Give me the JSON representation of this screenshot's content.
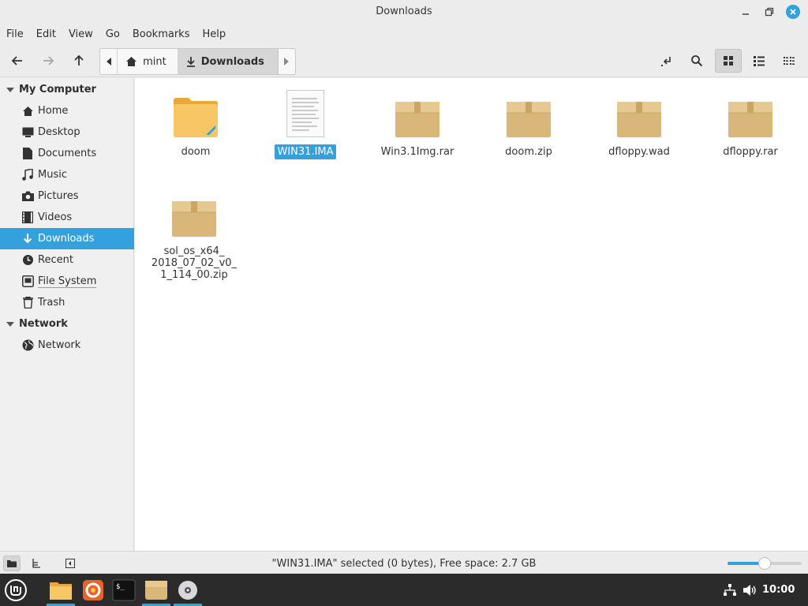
{
  "window": {
    "title": "Downloads"
  },
  "menu": [
    "File",
    "Edit",
    "View",
    "Go",
    "Bookmarks",
    "Help"
  ],
  "pathbar": {
    "crumbs": [
      {
        "label": "mint",
        "icon": "home-icon"
      },
      {
        "label": "Downloads",
        "icon": "download-icon"
      }
    ]
  },
  "sidebar": {
    "sections": [
      {
        "label": "My Computer",
        "items": [
          {
            "label": "Home",
            "icon": "home-icon"
          },
          {
            "label": "Desktop",
            "icon": "desktop-icon"
          },
          {
            "label": "Documents",
            "icon": "document-icon"
          },
          {
            "label": "Music",
            "icon": "music-icon"
          },
          {
            "label": "Pictures",
            "icon": "camera-icon"
          },
          {
            "label": "Videos",
            "icon": "film-icon"
          },
          {
            "label": "Downloads",
            "icon": "download-icon",
            "selected": true
          },
          {
            "label": "Recent",
            "icon": "clock-icon"
          },
          {
            "label": "File System",
            "icon": "drive-icon"
          },
          {
            "label": "Trash",
            "icon": "trash-icon"
          }
        ]
      },
      {
        "label": "Network",
        "items": [
          {
            "label": "Network",
            "icon": "globe-icon"
          }
        ]
      }
    ]
  },
  "files": [
    {
      "name": "doom",
      "type": "folder"
    },
    {
      "name": "WIN31.IMA",
      "type": "document",
      "selected": true
    },
    {
      "name": "Win3.1Img.rar",
      "type": "archive"
    },
    {
      "name": "doom.zip",
      "type": "archive"
    },
    {
      "name": "dfloppy.wad",
      "type": "archive"
    },
    {
      "name": "dfloppy.rar",
      "type": "archive"
    },
    {
      "name": "sol_os_x64_\n2018_07_02_v0_\n1_114_00.zip",
      "type": "archive"
    }
  ],
  "status": {
    "text": "\"WIN31.IMA\" selected (0 bytes), Free space: 2.7 GB",
    "zoom_level": 0.5
  },
  "taskbar": {
    "clock": "10:00"
  },
  "colors": {
    "accent": "#35a1dc",
    "folder": "#f5c04f",
    "archive": "#d9b77a"
  }
}
